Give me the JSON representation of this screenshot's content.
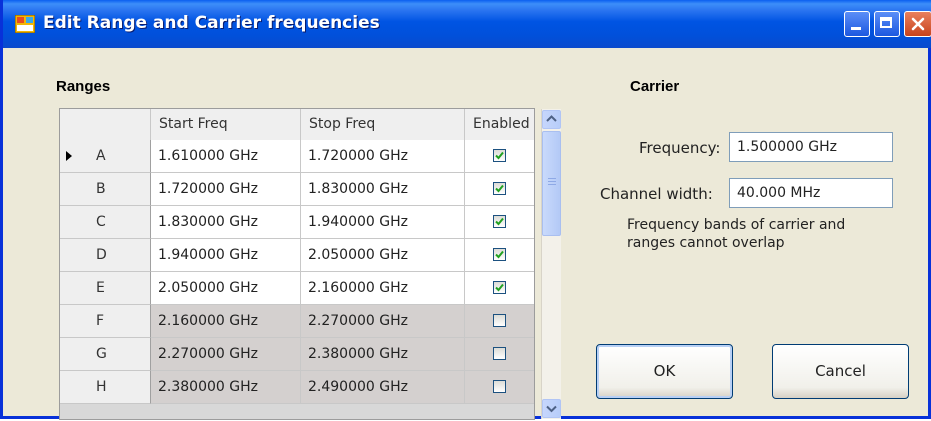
{
  "window": {
    "title": "Edit Range and Carrier frequencies",
    "controls": [
      "minimize-icon",
      "maximize-icon",
      "close-icon"
    ]
  },
  "ranges": {
    "section_label": "Ranges",
    "columns": [
      "Start Freq",
      "Stop Freq",
      "Enabled"
    ],
    "rows": [
      {
        "name": "A",
        "start": "1.610000 GHz",
        "stop": "1.720000 GHz",
        "enabled": true,
        "current": true
      },
      {
        "name": "B",
        "start": "1.720000 GHz",
        "stop": "1.830000 GHz",
        "enabled": true,
        "current": false
      },
      {
        "name": "C",
        "start": "1.830000 GHz",
        "stop": "1.940000 GHz",
        "enabled": true,
        "current": false
      },
      {
        "name": "D",
        "start": "1.940000 GHz",
        "stop": "2.050000 GHz",
        "enabled": true,
        "current": false
      },
      {
        "name": "E",
        "start": "2.050000 GHz",
        "stop": "2.160000 GHz",
        "enabled": true,
        "current": false
      },
      {
        "name": "F",
        "start": "2.160000 GHz",
        "stop": "2.270000 GHz",
        "enabled": false,
        "current": false
      },
      {
        "name": "G",
        "start": "2.270000 GHz",
        "stop": "2.380000 GHz",
        "enabled": false,
        "current": false
      },
      {
        "name": "H",
        "start": "2.380000 GHz",
        "stop": "2.490000 GHz",
        "enabled": false,
        "current": false
      }
    ]
  },
  "carrier": {
    "section_label": "Carrier",
    "frequency_label": "Frequency:",
    "frequency_value": "1.500000 GHz",
    "channel_width_label": "Channel width:",
    "channel_width_value": "40.000 MHz",
    "note": "Frequency bands of carrier and ranges cannot overlap"
  },
  "buttons": {
    "ok": "OK",
    "cancel": "Cancel"
  },
  "colors": {
    "titlebar": "#0054e3",
    "dialog_bg": "#ece9d8",
    "disabled_row": "#d4d0cf",
    "enabled_row": "#ffffff"
  }
}
